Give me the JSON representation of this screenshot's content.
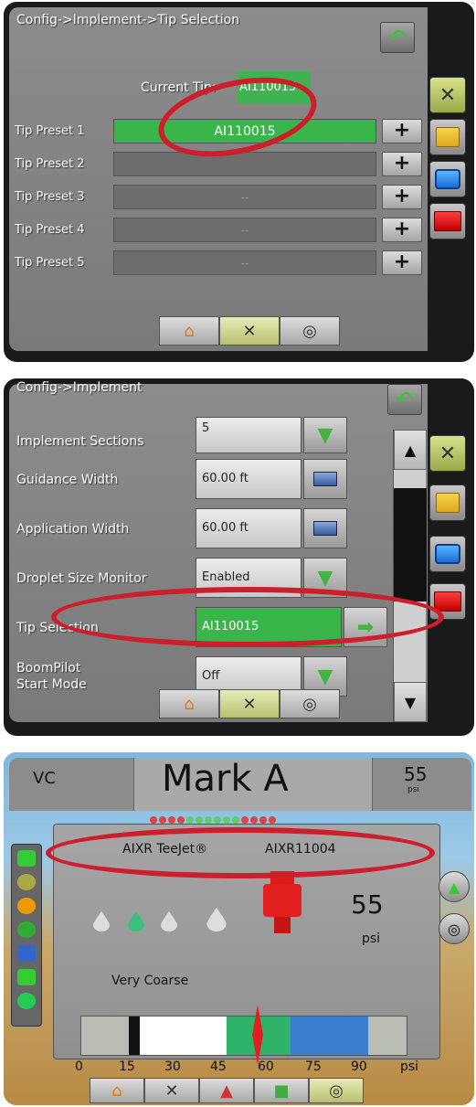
{
  "panel1": {
    "breadcrumb": "Config->Implement->Tip Selection",
    "current_tip_label": "Current Tip:",
    "current_tip_value": "AI110015",
    "presets": [
      {
        "label": "Tip Preset 1",
        "value": "AI110015"
      },
      {
        "label": "Tip Preset 2",
        "value": ""
      },
      {
        "label": "Tip Preset 3",
        "value": "--"
      },
      {
        "label": "Tip Preset 4",
        "value": "--"
      },
      {
        "label": "Tip Preset 5",
        "value": "--"
      }
    ],
    "add_label": "+"
  },
  "panel2": {
    "breadcrumb": "Config->Implement",
    "settings": [
      {
        "label": "Implement Sections",
        "value": "5"
      },
      {
        "label": "Guidance Width",
        "value": "60.00 ft"
      },
      {
        "label": "Application Width",
        "value": "60.00 ft"
      },
      {
        "label": "Droplet Size Monitor",
        "value": "Enabled"
      },
      {
        "label": "Tip Selection",
        "value": "AI110015"
      },
      {
        "label": "BoomPilot\nStart Mode",
        "value": "Off"
      }
    ]
  },
  "panel3": {
    "guidance_mode": "VC",
    "mark": "Mark A",
    "rate_value": "55",
    "rate_unit": "psi",
    "tip_brand": "AIXR TeeJet®",
    "tip_code": "AIXR11004",
    "pressure_value": "55",
    "pressure_unit": "psi",
    "droplet_class": "Very Coarse",
    "scale_ticks": [
      "0",
      "15",
      "30",
      "45",
      "60",
      "75",
      "90",
      "psi"
    ],
    "gauge_value_psi": 55,
    "colors": {
      "accent_green": "#39b54a",
      "highlight_red": "#cc1f2b",
      "scale_blue": "#3b7fd0"
    }
  },
  "icons": {
    "back": "back-arrow-icon",
    "tools": "tools-icon",
    "home": "home-icon",
    "gps": "gps-icon"
  }
}
